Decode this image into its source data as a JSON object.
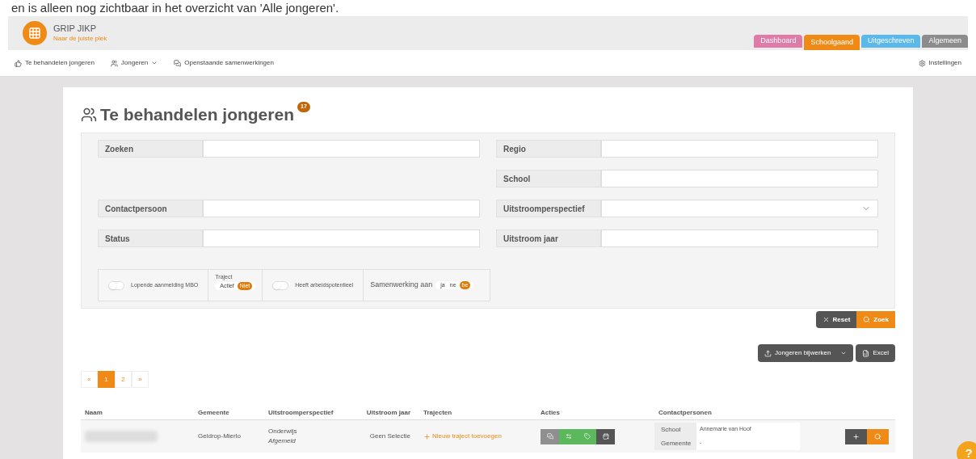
{
  "doc_text": "en is alleen nog zichtbaar in het overzicht van 'Alle jongeren'.",
  "app": {
    "title": "GRIP JIKP",
    "subtitle": "Naar de juiste plek"
  },
  "tabs": [
    {
      "label": "Dashboard",
      "selected": false,
      "color": "#e07aa6"
    },
    {
      "label": "Schoolgaand",
      "selected": true,
      "color": "#ef8a17"
    },
    {
      "label": "Uitgeschreven",
      "selected": false,
      "color": "#5bb8ea"
    },
    {
      "label": "Algemeen",
      "selected": false,
      "color": "#8c8c8c"
    }
  ],
  "nav": {
    "items": [
      {
        "kind": "thumb",
        "label": "Te behandelen jongeren",
        "dropdown": false
      },
      {
        "kind": "users",
        "label": "Jongeren",
        "dropdown": true
      },
      {
        "kind": "chat",
        "label": "Openstaande samenwerkingen",
        "dropdown": false
      }
    ],
    "settings": "Instellingen"
  },
  "page": {
    "title": "Te behandelen jongeren",
    "count": "17"
  },
  "filter_rows": [
    {
      "left": {
        "label": "Zoeken",
        "kind": "text"
      },
      "right": {
        "label": "Regio",
        "kind": "text"
      }
    },
    {
      "right": {
        "label": "School",
        "kind": "text"
      }
    },
    {
      "left": {
        "label": "Contactpersoon",
        "kind": "text"
      },
      "right": {
        "label": "Uitstroomperspectief",
        "kind": "select"
      }
    },
    {
      "left": {
        "label": "Status",
        "kind": "text"
      },
      "right": {
        "label": "Uitstroom jaar",
        "kind": "text"
      }
    }
  ],
  "toggles": [
    {
      "kind": "switch",
      "label": "Lopende aanmelding MBO",
      "on": false
    },
    {
      "kind": "segmented",
      "label": "Traject",
      "options": [
        {
          "label": "Actief",
          "selected": false
        },
        {
          "label": "Niet",
          "selected": true
        }
      ]
    },
    {
      "kind": "switch",
      "label": "Heeft arbeidspotentieel",
      "on": false
    },
    {
      "kind": "segmented",
      "label": "Samenwerking aan",
      "options": [
        {
          "label": "ja",
          "selected": false
        },
        {
          "label": "ne",
          "selected": false
        },
        {
          "label": "be",
          "selected": true
        }
      ]
    }
  ],
  "search_buttons": [
    {
      "kind": "reset",
      "label": "Reset"
    },
    {
      "kind": "search",
      "label": "Zoek"
    }
  ],
  "toolbar": [
    {
      "kind": "upload",
      "label": "Jongeren bijwerken"
    },
    {
      "kind": "excel",
      "label": "Excel"
    }
  ],
  "pagination": [
    {
      "label": "«",
      "selected": false
    },
    {
      "label": "1",
      "selected": true
    },
    {
      "label": "2",
      "selected": false
    },
    {
      "label": "»",
      "selected": false
    }
  ],
  "table": {
    "columns": [
      "Naam",
      "Gemeente",
      "Uitstroomperspectief",
      "Uitstroom jaar",
      "Trajecten",
      "Acties",
      "Contactpersonen"
    ],
    "rows": [
      {
        "gemeente": "Geldrop-Mierlo",
        "perspectief": "Onderwijs",
        "status": "Afgemeld",
        "jaar": "Geen Selectie",
        "traject": "Nieuw traject toevoegen",
        "actions": [
          {
            "kind": "chat",
            "color": "#8f8f8f"
          },
          {
            "kind": "swap",
            "color": "#5cb85c"
          },
          {
            "kind": "tag",
            "color": "#5cb85c"
          },
          {
            "kind": "calendar",
            "color": "#555555"
          }
        ],
        "contacts": [
          {
            "role": "School",
            "name": "Annemarie van Hoof"
          },
          {
            "role": "Gemeente",
            "name": "-"
          }
        ]
      }
    ]
  },
  "help": "?"
}
